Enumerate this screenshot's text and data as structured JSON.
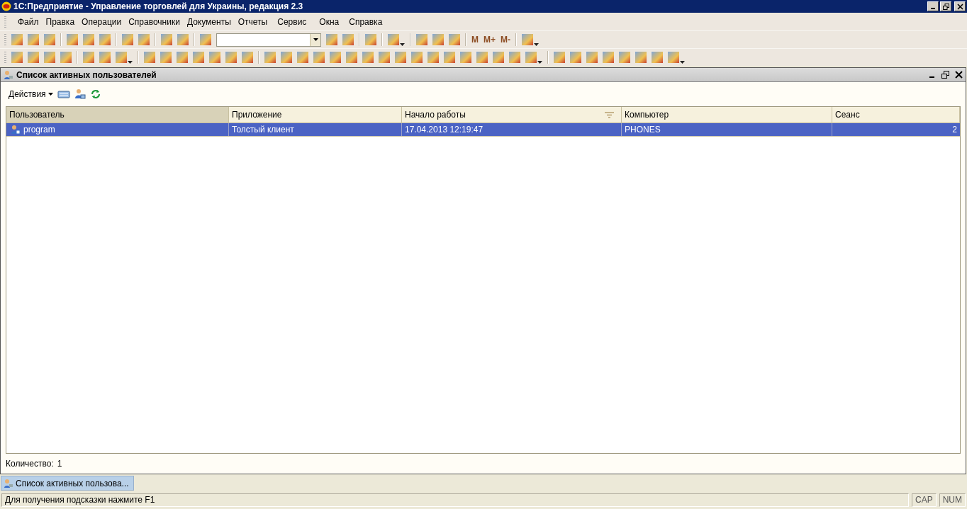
{
  "window": {
    "title": "1С:Предприятие - Управление торговлей для Украины, редакция 2.3"
  },
  "menu": [
    "Файл",
    "Правка",
    "Операции",
    "Справочники",
    "Документы",
    "Отчеты",
    "Сервис",
    "Окна",
    "Справка"
  ],
  "toolbar": {
    "memory_buttons": [
      "M",
      "M+",
      "M-"
    ]
  },
  "subwindow": {
    "title": "Список активных пользователей",
    "actions_label": "Действия",
    "columns": [
      {
        "label": "Пользователь",
        "selected": true,
        "filter": false,
        "kind": "text"
      },
      {
        "label": "Приложение",
        "selected": false,
        "filter": false,
        "kind": "text"
      },
      {
        "label": "Начало работы",
        "selected": false,
        "filter": true,
        "kind": "text"
      },
      {
        "label": "Компьютер",
        "selected": false,
        "filter": false,
        "kind": "text"
      },
      {
        "label": "Сеанс",
        "selected": false,
        "filter": false,
        "kind": "number"
      }
    ],
    "rows": [
      {
        "selected": true,
        "cells": [
          "program",
          "Толстый клиент",
          "17.04.2013 12:19:47",
          "PHONES",
          "2"
        ]
      }
    ],
    "count_label": "Количество:",
    "count": "1"
  },
  "taskbar": [
    {
      "label": "Список активных пользова...",
      "selected": true
    }
  ],
  "status_bar": {
    "hint": "Для получения подсказки нажмите F1",
    "indicators": [
      "CAP",
      "NUM"
    ]
  }
}
